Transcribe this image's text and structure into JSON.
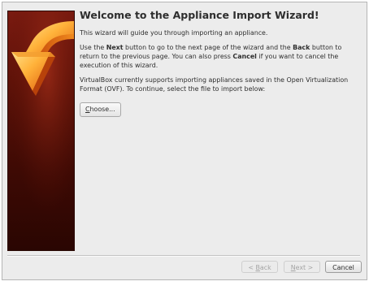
{
  "wizard": {
    "title": "Welcome to the Appliance Import Wizard!",
    "intro": "This wizard will guide you through importing an appliance.",
    "nav_help": {
      "p1": "Use the ",
      "next_word": "Next",
      "p2": " button to go to the next page of the wizard and the ",
      "back_word": "Back",
      "p3": " button to return to the previous page. You can also press ",
      "cancel_word": "Cancel",
      "p4": " if you want to cancel the execution of this wizard."
    },
    "ovf_text": "VirtualBox currently supports importing appliances saved in the Open Virtualization Format (OVF). To continue, select the file to import below:",
    "choose_button": {
      "mnemonic": "C",
      "rest": "hoose..."
    }
  },
  "footer": {
    "back_button": {
      "prefix": "< ",
      "mnemonic": "B",
      "rest": "ack",
      "enabled": false
    },
    "next_button": {
      "mnemonic": "N",
      "rest": "ext >",
      "enabled": false
    },
    "cancel_button": {
      "label": "Cancel",
      "enabled": true
    }
  },
  "banner": {
    "icon": "orange-curved-import-arrow-icon",
    "colors": {
      "banner_top": "#7a1a10",
      "banner_bottom": "#2a0602",
      "arrow_light": "#ffc24a",
      "arrow_dark": "#e06a10"
    }
  }
}
